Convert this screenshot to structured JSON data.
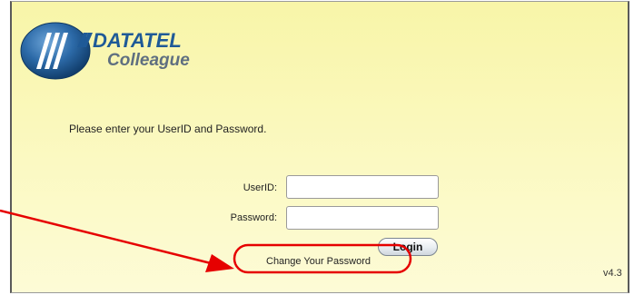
{
  "logo": {
    "brand": "DATATEL",
    "product": "Colleague"
  },
  "instructions": "Please enter your UserID and Password.",
  "form": {
    "userid_label": "UserID:",
    "userid_value": "",
    "password_label": "Password:",
    "password_value": "",
    "login_label": "Login"
  },
  "change_password_link": "Change Your Password",
  "version": "v4.3",
  "colors": {
    "background_yellow": "#fbf9c2",
    "logo_blue": "#1f5a97",
    "annotation_red": "#e60000"
  }
}
